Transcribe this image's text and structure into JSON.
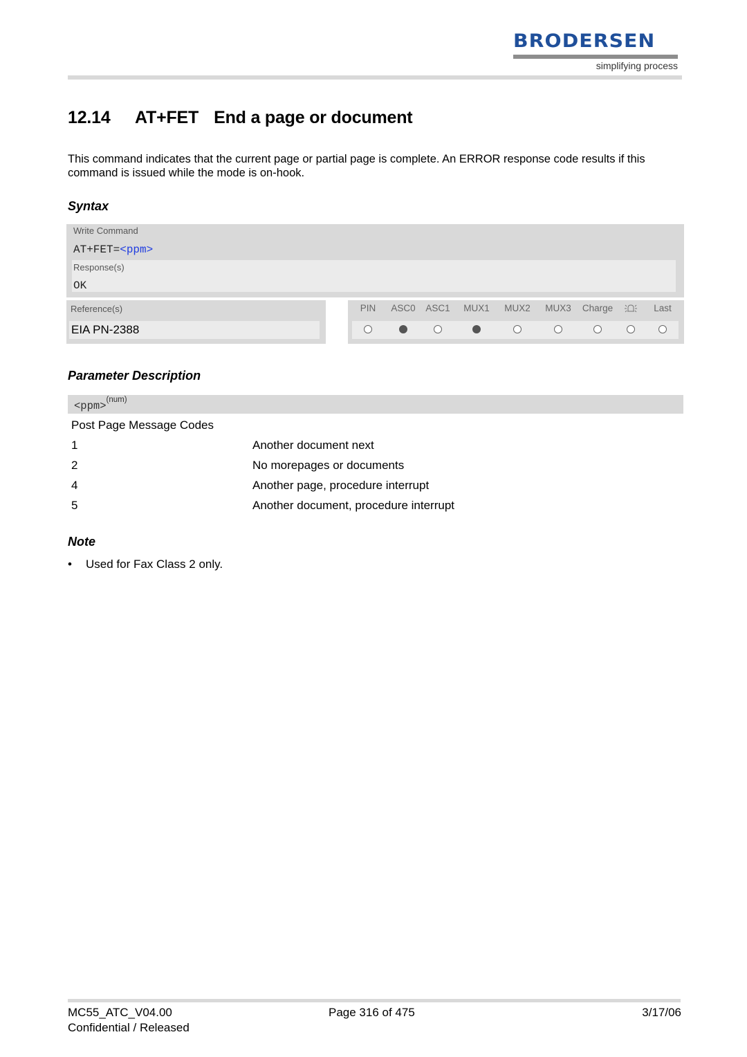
{
  "header": {
    "logo_text": "BRODERSEN",
    "logo_tagline": "simplifying process",
    "brand_color": "#1f4f9a"
  },
  "section": {
    "number": "12.14",
    "command": "AT+FET",
    "title": "End a page or document"
  },
  "intro": "This command indicates that the current page or partial page is complete. An ERROR response code results if this command is issued while the mode is on-hook.",
  "syntax": {
    "heading": "Syntax",
    "write_command_label": "Write Command",
    "command_prefix": "AT+FET=",
    "command_param": "<ppm>",
    "responses_label": "Response(s)",
    "response": "OK",
    "references_label": "Reference(s)",
    "reference": "EIA PN-2388",
    "flags": [
      {
        "label": "PIN",
        "value": false
      },
      {
        "label": "ASC0",
        "value": true
      },
      {
        "label": "ASC1",
        "value": false
      },
      {
        "label": "MUX1",
        "value": true
      },
      {
        "label": "MUX2",
        "value": false
      },
      {
        "label": "MUX3",
        "value": false
      },
      {
        "label": "Charge",
        "value": false
      },
      {
        "label": "bell-icon",
        "value": false,
        "icon": true
      },
      {
        "label": "Last",
        "value": false
      }
    ],
    "param_color": "#1f3ce0"
  },
  "parameters": {
    "heading": "Parameter Description",
    "name": "<ppm>",
    "type": "(num)",
    "description": "Post Page Message Codes",
    "values": [
      {
        "value": "1",
        "desc": "Another document next"
      },
      {
        "value": "2",
        "desc": "No morepages or documents"
      },
      {
        "value": "4",
        "desc": "Another page, procedure interrupt"
      },
      {
        "value": "5",
        "desc": "Another document, procedure interrupt"
      }
    ]
  },
  "note": {
    "heading": "Note",
    "bullet": "•",
    "items": [
      "Used for Fax Class 2 only."
    ]
  },
  "footer": {
    "doc_id": "MC55_ATC_V04.00",
    "page": "Page 316 of 475",
    "date": "3/17/06",
    "status": "Confidential / Released"
  }
}
